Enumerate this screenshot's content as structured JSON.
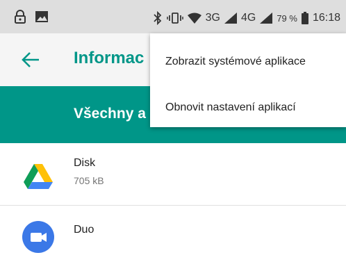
{
  "status_bar": {
    "network_3g": "3G",
    "network_4g": "4G",
    "battery_percent": "79 %",
    "time": "16:18",
    "icons": [
      "lock-icon",
      "image-icon",
      "bluetooth-icon",
      "vibrate-icon",
      "wifi-icon",
      "signal-icon",
      "battery-icon"
    ]
  },
  "toolbar": {
    "title": "Informac"
  },
  "filter": {
    "label": "Všechny a"
  },
  "apps": [
    {
      "name": "Disk",
      "size": "705 kB",
      "icon": "google-drive-icon"
    },
    {
      "name": "Duo",
      "size": "",
      "icon": "google-duo-icon"
    }
  ],
  "menu": {
    "items": [
      {
        "label": "Zobrazit systémové aplikace"
      },
      {
        "label": "Obnovit nastavení aplikací"
      }
    ]
  },
  "colors": {
    "accent": "#009688",
    "statusbar_bg": "#dedede",
    "toolbar_bg": "#f5f5f5"
  }
}
